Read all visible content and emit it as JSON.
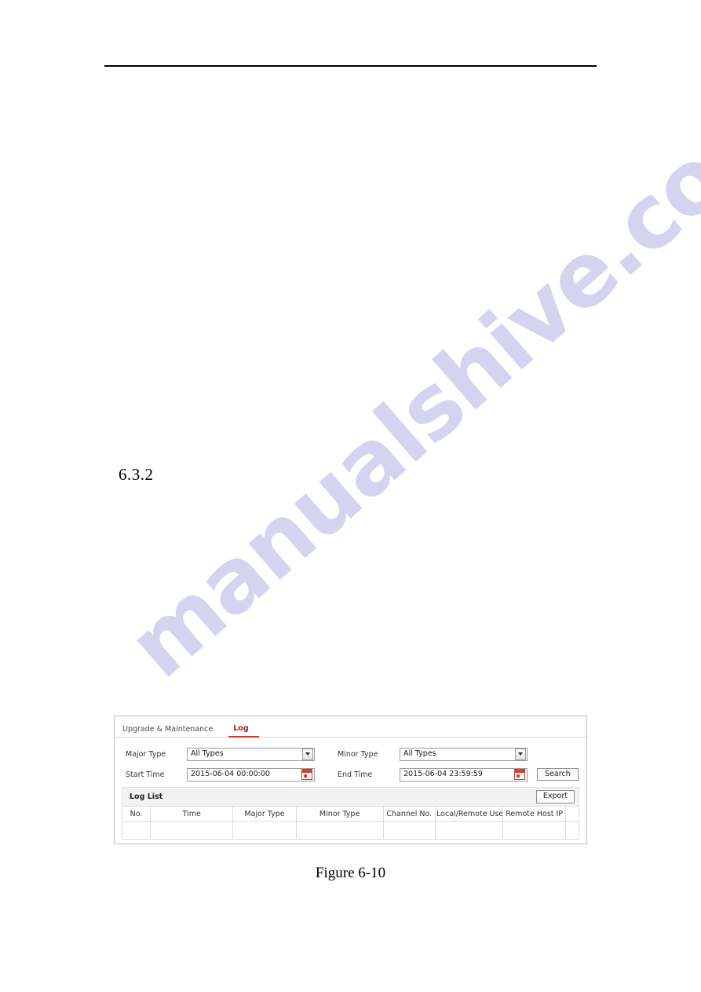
{
  "document": {
    "section_number": "6.3.2",
    "figure_caption": "Figure 6-10",
    "watermark": "manualshive.com"
  },
  "panel": {
    "tabs": [
      {
        "label": "Upgrade & Maintenance",
        "active": false
      },
      {
        "label": "Log",
        "active": true
      }
    ],
    "form": {
      "major_type_label": "Major Type",
      "major_type_value": "All Types",
      "minor_type_label": "Minor Type",
      "minor_type_value": "All Types",
      "start_time_label": "Start Time",
      "start_time_value": "2015-06-04 00:00:00",
      "end_time_label": "End Time",
      "end_time_value": "2015-06-04 23:59:59",
      "search_button": "Search"
    },
    "log_list": {
      "title": "Log List",
      "export_button": "Export",
      "columns": [
        "No.",
        "Time",
        "Major Type",
        "Minor Type",
        "Channel No.",
        "Local/Remote User",
        "Remote Host IP"
      ],
      "rows": []
    },
    "icons": {
      "dropdown": "chevron-down-icon",
      "calendar": "calendar-icon"
    },
    "colors": {
      "active_tab": "#b01a1a",
      "tab_underline": "#c0392b",
      "panel_border": "#bdbdbd",
      "loglist_bg": "#f2f2f2"
    }
  }
}
